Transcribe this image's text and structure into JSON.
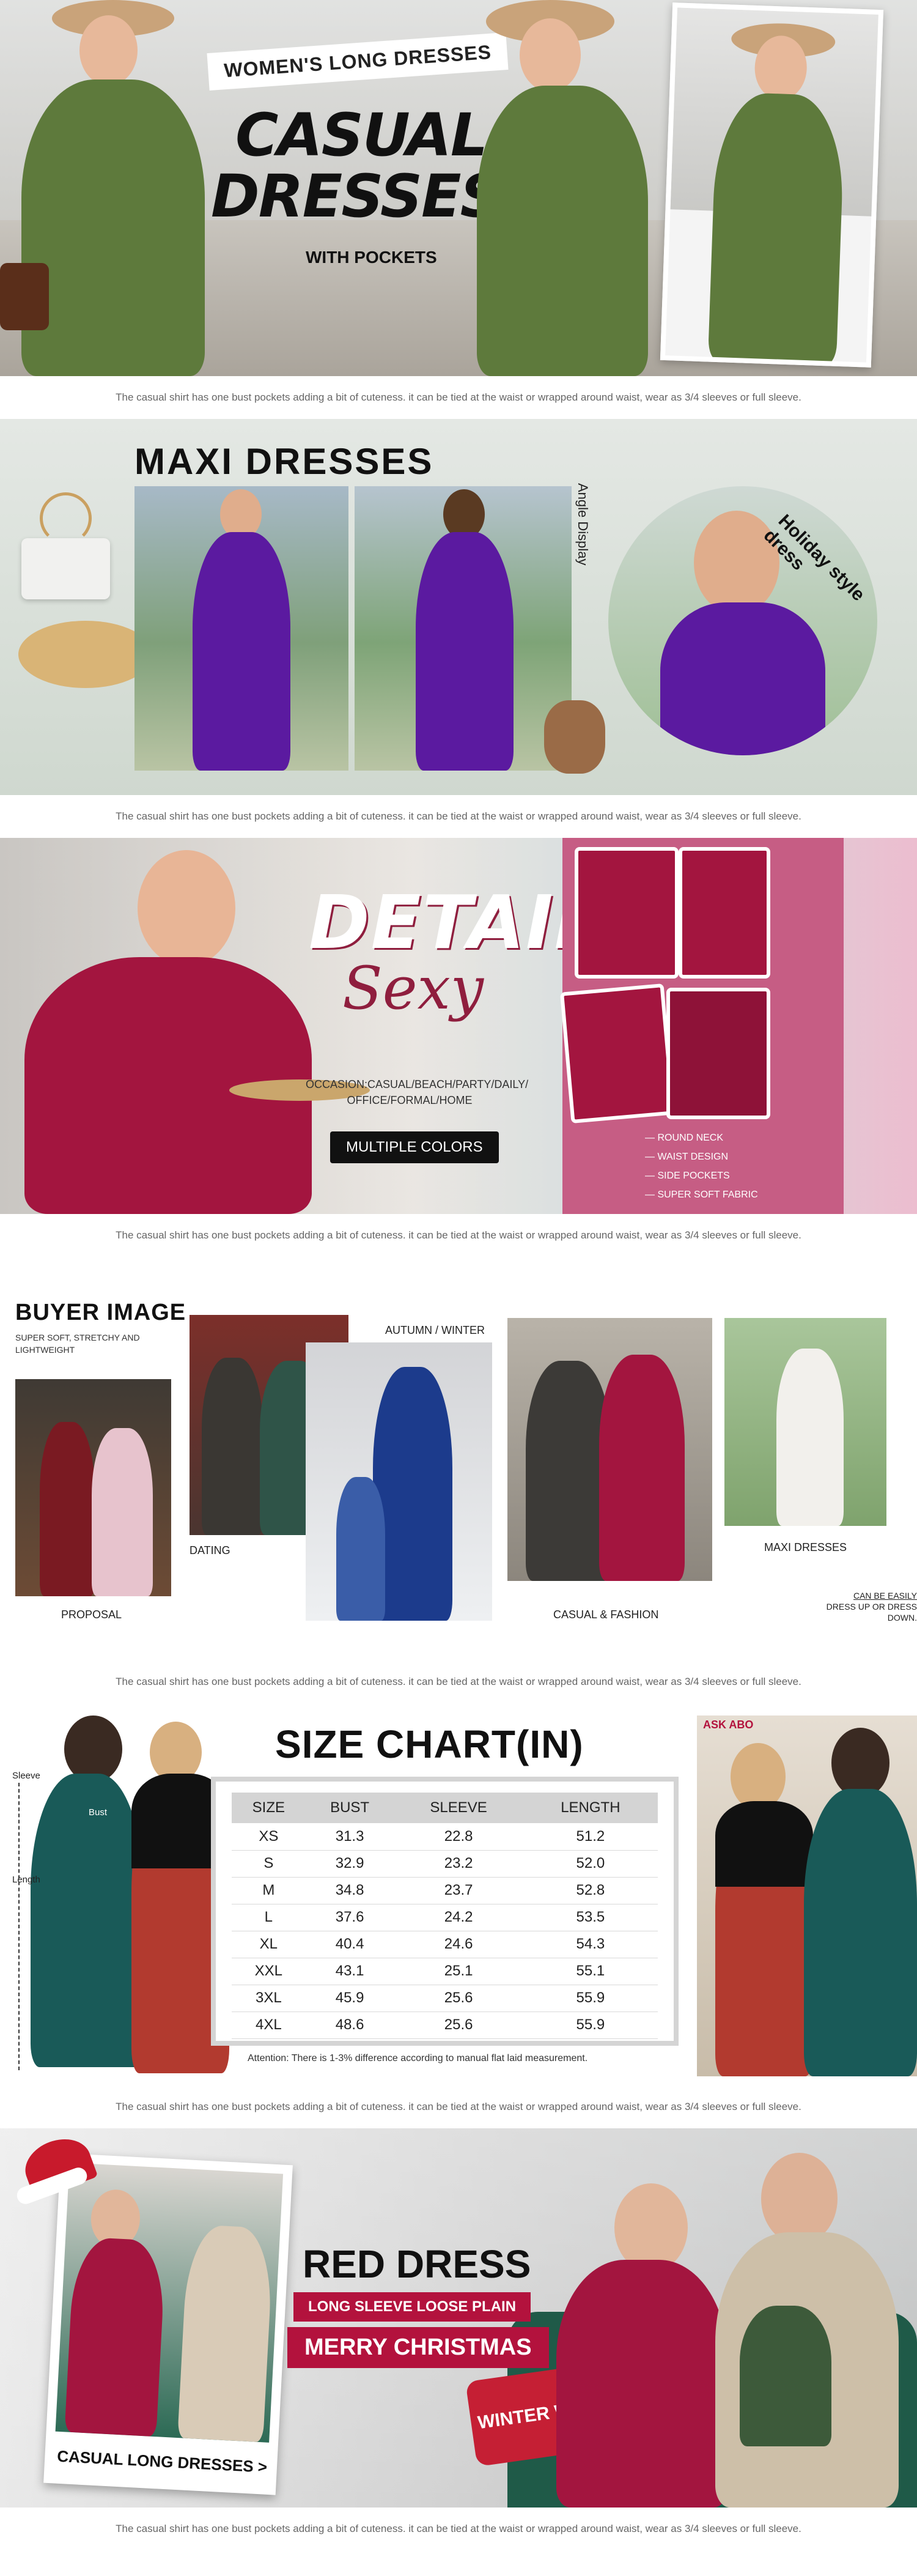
{
  "caption": "The casual shirt has one bust pockets adding a bit of cuteness. it can be tied at the waist or wrapped around waist, wear as 3/4 sleeves or full sleeve.",
  "hero": {
    "tag": "WOMEN'S LONG DRESSES",
    "title_line1": "CASUAL",
    "title_line2": "DRESSES",
    "subtitle": "WITH POCKETS",
    "dress_color": "#5e7a3c"
  },
  "maxi": {
    "title": "MAXI DRESSES",
    "angle_label": "Angle Display",
    "holiday_label": "Holiday style dress",
    "dress_color": "#5b1aa0"
  },
  "detail": {
    "title": "DETAIL",
    "script": "Sexy",
    "occasion_line1": "OCCASION:CASUAL/BEACH/PARTY/DAILY/",
    "occasion_line2": "OFFICE/FORMAL/HOME",
    "button": "MULTIPLE COLORS",
    "features": [
      "ROUND NECK",
      "WAIST DESIGN",
      "SIDE POCKETS",
      "SUPER SOFT FABRIC"
    ],
    "dress_color": "#a3153f"
  },
  "buyer": {
    "title": "BUYER IMAGE",
    "subtitle_line1": "SUPER SOFT, STRETCHY AND",
    "subtitle_line2": "LIGHTWEIGHT",
    "labels": {
      "proposal": "PROPOSAL",
      "dating": "DATING",
      "autumn_winter": "AUTUMN / WINTER",
      "casual_fashion": "CASUAL & FASHION",
      "maxi_dresses": "MAXI DRESSES",
      "note_line1": "CAN BE EASILY",
      "note_line2": "DRESS UP OR DRESS DOWN."
    }
  },
  "size_chart": {
    "title": "SIZE CHART(IN)",
    "figure_labels": {
      "sleeve": "Sleeve",
      "bust": "Bust",
      "length": "Length"
    },
    "headers": [
      "SIZE",
      "BUST",
      "SLEEVE",
      "LENGTH"
    ],
    "rows": [
      [
        "XS",
        "31.3",
        "22.8",
        "51.2"
      ],
      [
        "S",
        "32.9",
        "23.2",
        "52.0"
      ],
      [
        "M",
        "34.8",
        "23.7",
        "52.8"
      ],
      [
        "L",
        "37.6",
        "24.2",
        "53.5"
      ],
      [
        "XL",
        "40.4",
        "24.6",
        "54.3"
      ],
      [
        "XXL",
        "43.1",
        "25.1",
        "55.1"
      ],
      [
        "3XL",
        "45.9",
        "25.6",
        "55.9"
      ],
      [
        "4XL",
        "48.6",
        "25.6",
        "55.9"
      ]
    ],
    "attention": "Attention: There is 1-3% difference according to manual flat laid measurement.",
    "sign_text": "ASK ABO"
  },
  "christmas": {
    "title": "RED DRESS",
    "ribbon1": "LONG SLEEVE LOOSE PLAIN",
    "ribbon2": "MERRY CHRISTMAS",
    "link": "CASUAL LONG DRESSES >",
    "pillow_text": "WINTER WO",
    "dress_color": "#a3153f"
  }
}
